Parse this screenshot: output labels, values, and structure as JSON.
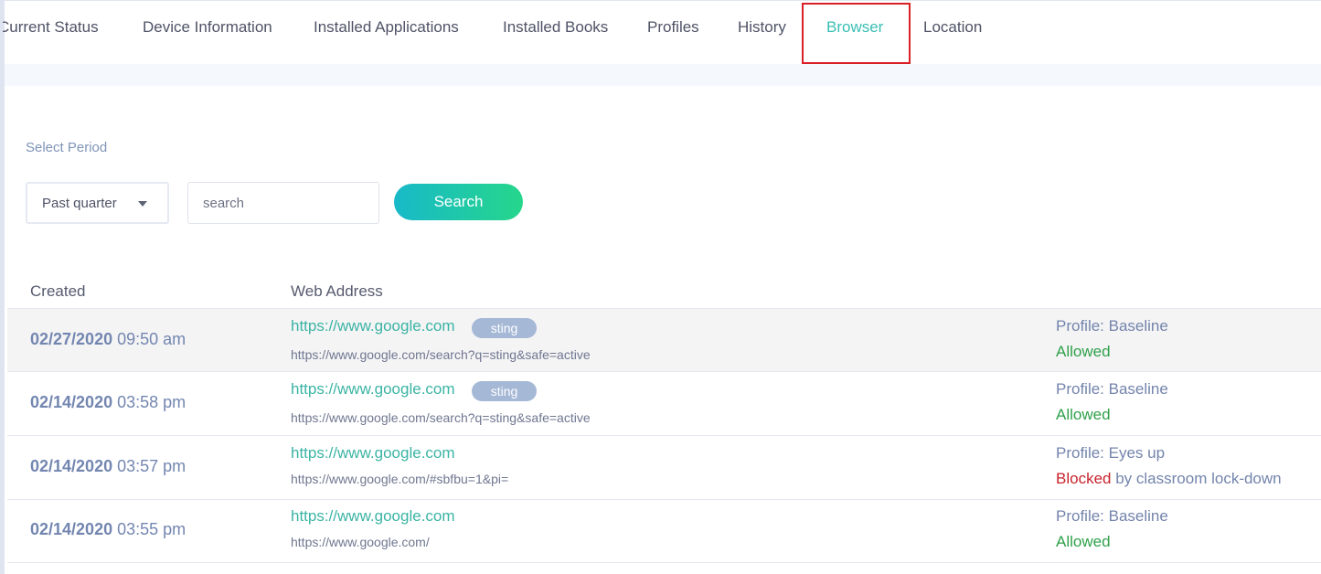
{
  "tabs": [
    {
      "label": "Current Status",
      "display": "Current Status"
    },
    {
      "label": "Device Information"
    },
    {
      "label": "Installed Applications"
    },
    {
      "label": "Installed Books"
    },
    {
      "label": "Profiles"
    },
    {
      "label": "History"
    },
    {
      "label": "Browser"
    },
    {
      "label": "Location"
    }
  ],
  "active_tab": "Browser",
  "filters": {
    "period_label": "Select Period",
    "period_value": "Past quarter",
    "search_placeholder": "search",
    "search_button": "Search"
  },
  "table": {
    "columns": [
      "Created",
      "Web Address"
    ],
    "rows": [
      {
        "date": "02/27/2020",
        "time": "09:50 am",
        "url": "https://www.google.com",
        "tag": "sting",
        "full_url": "https://www.google.com/search?q=sting&safe=active",
        "profile": "Profile: Baseline",
        "status": "Allowed",
        "reason": ""
      },
      {
        "date": "02/14/2020",
        "time": "03:58 pm",
        "url": "https://www.google.com",
        "tag": "sting",
        "full_url": "https://www.google.com/search?q=sting&safe=active",
        "profile": "Profile: Baseline",
        "status": "Allowed",
        "reason": ""
      },
      {
        "date": "02/14/2020",
        "time": "03:57 pm",
        "url": "https://www.google.com",
        "tag": "",
        "full_url": "https://www.google.com/#sbfbu=1&pi=",
        "profile": "Profile: Eyes up",
        "status": "Blocked",
        "reason": "by classroom lock-down"
      },
      {
        "date": "02/14/2020",
        "time": "03:55 pm",
        "url": "https://www.google.com",
        "tag": "",
        "full_url": "https://www.google.com/",
        "profile": "Profile: Baseline",
        "status": "Allowed",
        "reason": ""
      }
    ]
  },
  "colors": {
    "accent": "#3bbfb4",
    "highlight_box": "#d91f26",
    "allowed": "#2fa04a",
    "blocked": "#c8232c",
    "search_gradient_start": "#18b9c8",
    "search_gradient_end": "#26d68b",
    "tag_bg": "#a5b8d6"
  },
  "icons": {
    "period_dropdown": "caret-down-icon"
  }
}
